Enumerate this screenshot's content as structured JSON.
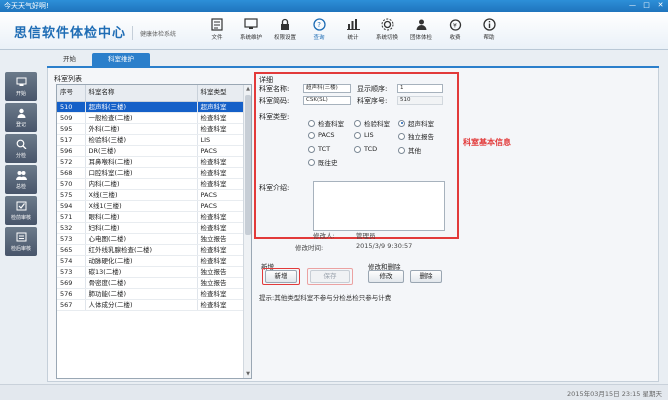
{
  "titlebar": {
    "text": "今天天气好啊!",
    "min": "—",
    "max": "□",
    "close": "✕"
  },
  "header": {
    "brand": "思信软件体检中心",
    "subtitle": "健康体检系统"
  },
  "toolbar": [
    {
      "label": "文件",
      "icon": "file-icon"
    },
    {
      "label": "系统维护",
      "icon": "system-maintenance-icon"
    },
    {
      "label": "权限设置",
      "icon": "permission-icon"
    },
    {
      "label": "查询",
      "icon": "query-icon"
    },
    {
      "label": "统计",
      "icon": "statistics-icon"
    },
    {
      "label": "系统切换",
      "icon": "switch-icon"
    },
    {
      "label": "团体体检",
      "icon": "group-exam-icon"
    },
    {
      "label": "收费",
      "icon": "fee-icon"
    },
    {
      "label": "帮助",
      "icon": "help-icon"
    }
  ],
  "sidebar": [
    {
      "label": "开始",
      "icon": "start-icon"
    },
    {
      "label": "登记",
      "icon": "register-icon"
    },
    {
      "label": "分检",
      "icon": "sub-check-icon"
    },
    {
      "label": "总检",
      "icon": "general-check-icon"
    },
    {
      "label": "检前审核",
      "icon": "pre-audit-icon"
    },
    {
      "label": "检后审核",
      "icon": "post-audit-icon"
    }
  ],
  "tabs": [
    "开始",
    "科室维护"
  ],
  "list": {
    "title": "科室列表",
    "columns": [
      "序号",
      "科室名称",
      "科室类型"
    ],
    "rows": [
      [
        "510",
        "超声科(三楼)",
        "超声科室"
      ],
      [
        "509",
        "一般检查(二楼)",
        "检查科室"
      ],
      [
        "595",
        "外科(二楼)",
        "检查科室"
      ],
      [
        "517",
        "检验科(三楼)",
        "LIS"
      ],
      [
        "596",
        "DR(三楼)",
        "PACS"
      ],
      [
        "572",
        "耳鼻喉科(二楼)",
        "检查科室"
      ],
      [
        "568",
        "口腔科室(二楼)",
        "检查科室"
      ],
      [
        "570",
        "内科(二楼)",
        "检查科室"
      ],
      [
        "575",
        "X线(三楼)",
        "PACS"
      ],
      [
        "594",
        "X线1(三楼)",
        "PACS"
      ],
      [
        "571",
        "眼科(二楼)",
        "检查科室"
      ],
      [
        "532",
        "妇科(二楼)",
        "检查科室"
      ],
      [
        "573",
        "心电图(二楼)",
        "独立报告"
      ],
      [
        "565",
        "红外线乳腺检查(二楼)",
        "检查科室"
      ],
      [
        "574",
        "动脉硬化(二楼)",
        "检查科室"
      ],
      [
        "573",
        "碳13(二楼)",
        "独立报告"
      ],
      [
        "569",
        "骨密度(二楼)",
        "独立报告"
      ],
      [
        "576",
        "肺功能(二楼)",
        "检查科室"
      ],
      [
        "567",
        "人体成分(二楼)",
        "检查科室"
      ]
    ]
  },
  "detail": {
    "title": "详细",
    "annotation": "科室基本信息",
    "name_label": "科室名称:",
    "name_value": "超声科(三楼)",
    "order_label": "显示顺序:",
    "order_value": "1",
    "code_label": "科室简码:",
    "code_value": "CSK(SL)",
    "seq_label": "科室序号:",
    "seq_value": "510",
    "type_label": "科室类型:",
    "types": [
      "检查科室",
      "检验科室",
      "超声科室",
      "PACS",
      "LIS",
      "独立报告",
      "TCT",
      "TCD",
      "其他",
      "既往史"
    ],
    "selected_type": "超声科室",
    "intro_label": "科室介绍:"
  },
  "meta": {
    "modifier_label": "修改人:",
    "modifier_value": "管理员",
    "time_label": "修改时间:",
    "time_value": "2015/3/9 9:30:57"
  },
  "actions": {
    "add_group": "新增",
    "add_label": "新增",
    "save_label": "保存",
    "edit_group": "修改和删除",
    "modify_label": "修改",
    "delete_label": "删除"
  },
  "hint": "提示:其他类型科室不参与分检总检只参与计费",
  "status": {
    "clock": "2015年03月15日 23:15 星期天"
  }
}
